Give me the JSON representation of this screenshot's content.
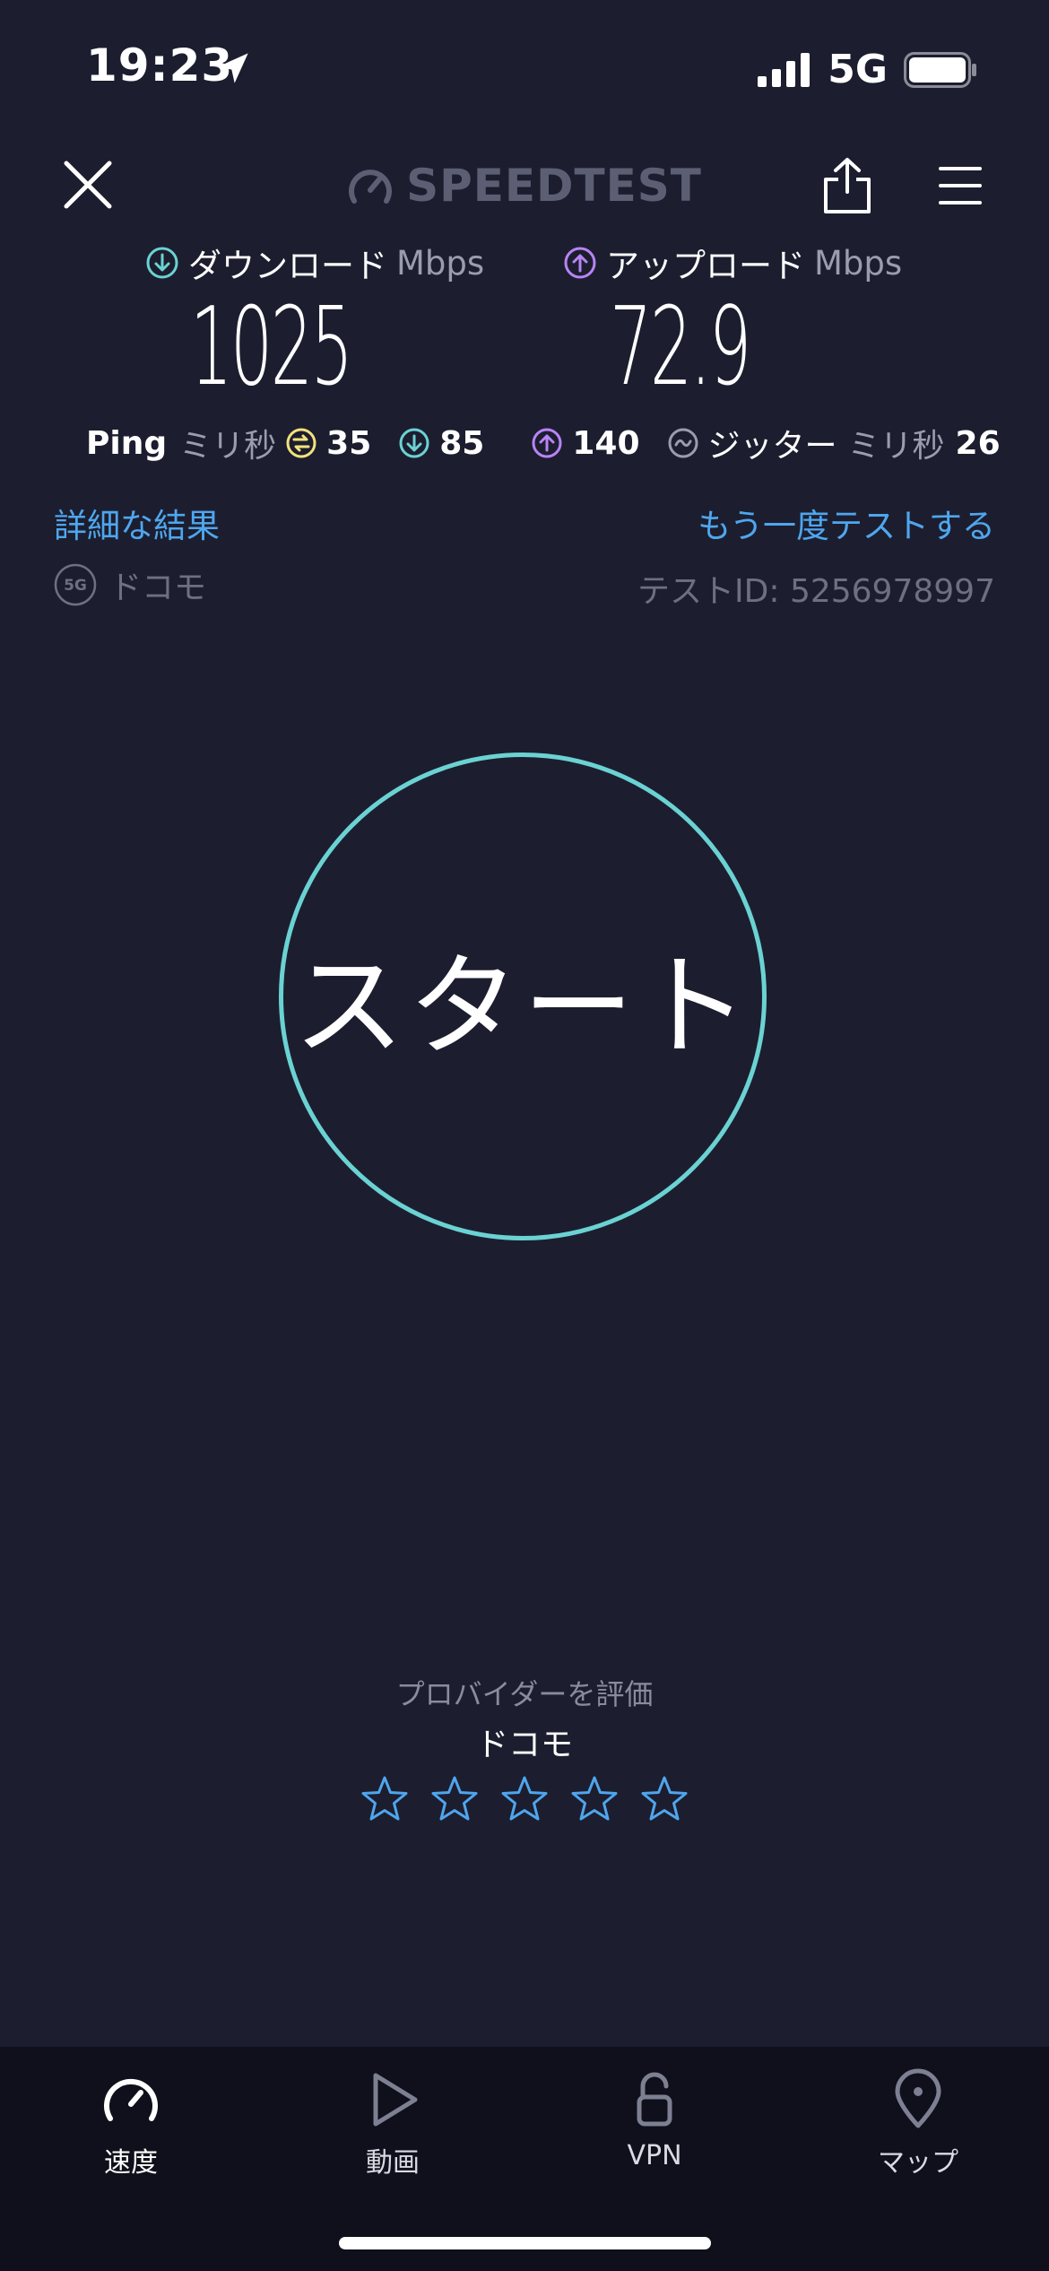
{
  "status_bar": {
    "time": "19:23",
    "network": "5G"
  },
  "header": {
    "logo_text": "SPEEDTEST"
  },
  "download": {
    "label": "ダウンロード",
    "unit": "Mbps",
    "value": "1025",
    "color": "#6bd2d3"
  },
  "upload": {
    "label": "アップロード",
    "unit": "Mbps",
    "value": "72.9",
    "color": "#b884f5"
  },
  "ping": {
    "label": "Ping",
    "unit": "ミリ秒",
    "idle": "35",
    "download": "85",
    "upload": "140",
    "jitter_label": "ジッター",
    "jitter_unit": "ミリ秒",
    "jitter": "26",
    "idle_color": "#f3e27c"
  },
  "links": {
    "details": "詳細な結果",
    "retest": "もう一度テストする"
  },
  "carrier": {
    "badge": "5G",
    "name": "ドコモ"
  },
  "test_id": "テストID: 5256978997",
  "start_button": {
    "label": "スタート",
    "ring_color": "#6bd2d3"
  },
  "rating": {
    "title": "プロバイダーを評価",
    "provider": "ドコモ",
    "stars": 5,
    "star_color": "#4fa6ee"
  },
  "nav": {
    "items": [
      {
        "label": "速度",
        "icon": "speedometer-icon",
        "active": true
      },
      {
        "label": "動画",
        "icon": "play-icon",
        "active": false
      },
      {
        "label": "VPN",
        "icon": "unlock-icon",
        "active": false
      },
      {
        "label": "マップ",
        "icon": "map-pin-icon",
        "active": false
      }
    ]
  }
}
